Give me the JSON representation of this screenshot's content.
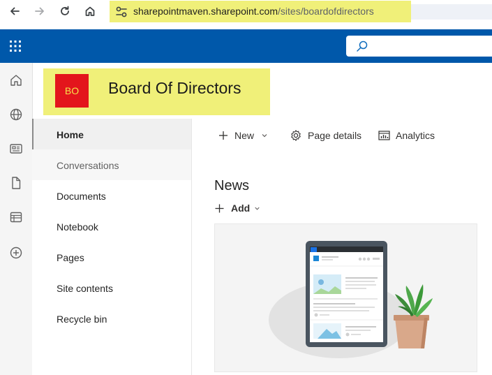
{
  "browser": {
    "url_host": "sharepointmaven.sharepoint.com",
    "url_path": "/sites/boardofdirectors"
  },
  "icons": {
    "back": "arrow-left-icon",
    "forward": "arrow-right-icon",
    "reload": "reload-icon",
    "home": "home-icon",
    "site_info": "tune-icon",
    "waffle": "app-launcher-icon",
    "search": "search-icon",
    "rail": [
      "home-icon",
      "globe-icon",
      "news-icon",
      "document-icon",
      "lists-icon",
      "add-icon"
    ]
  },
  "site": {
    "logo_initials": "BO",
    "title": "Board Of Directors",
    "logo_color": "#e3151c",
    "logo_text_color": "#f6e24b"
  },
  "colors": {
    "suite_bar": "#0058aa",
    "highlight": "#f0f079"
  },
  "nav": {
    "items": [
      {
        "label": "Home"
      },
      {
        "label": "Conversations"
      },
      {
        "label": "Documents"
      },
      {
        "label": "Notebook"
      },
      {
        "label": "Pages"
      },
      {
        "label": "Site contents"
      },
      {
        "label": "Recycle bin"
      }
    ]
  },
  "commandbar": {
    "new_label": "New",
    "page_details_label": "Page details",
    "analytics_label": "Analytics"
  },
  "news": {
    "title": "News",
    "add_label": "Add"
  }
}
